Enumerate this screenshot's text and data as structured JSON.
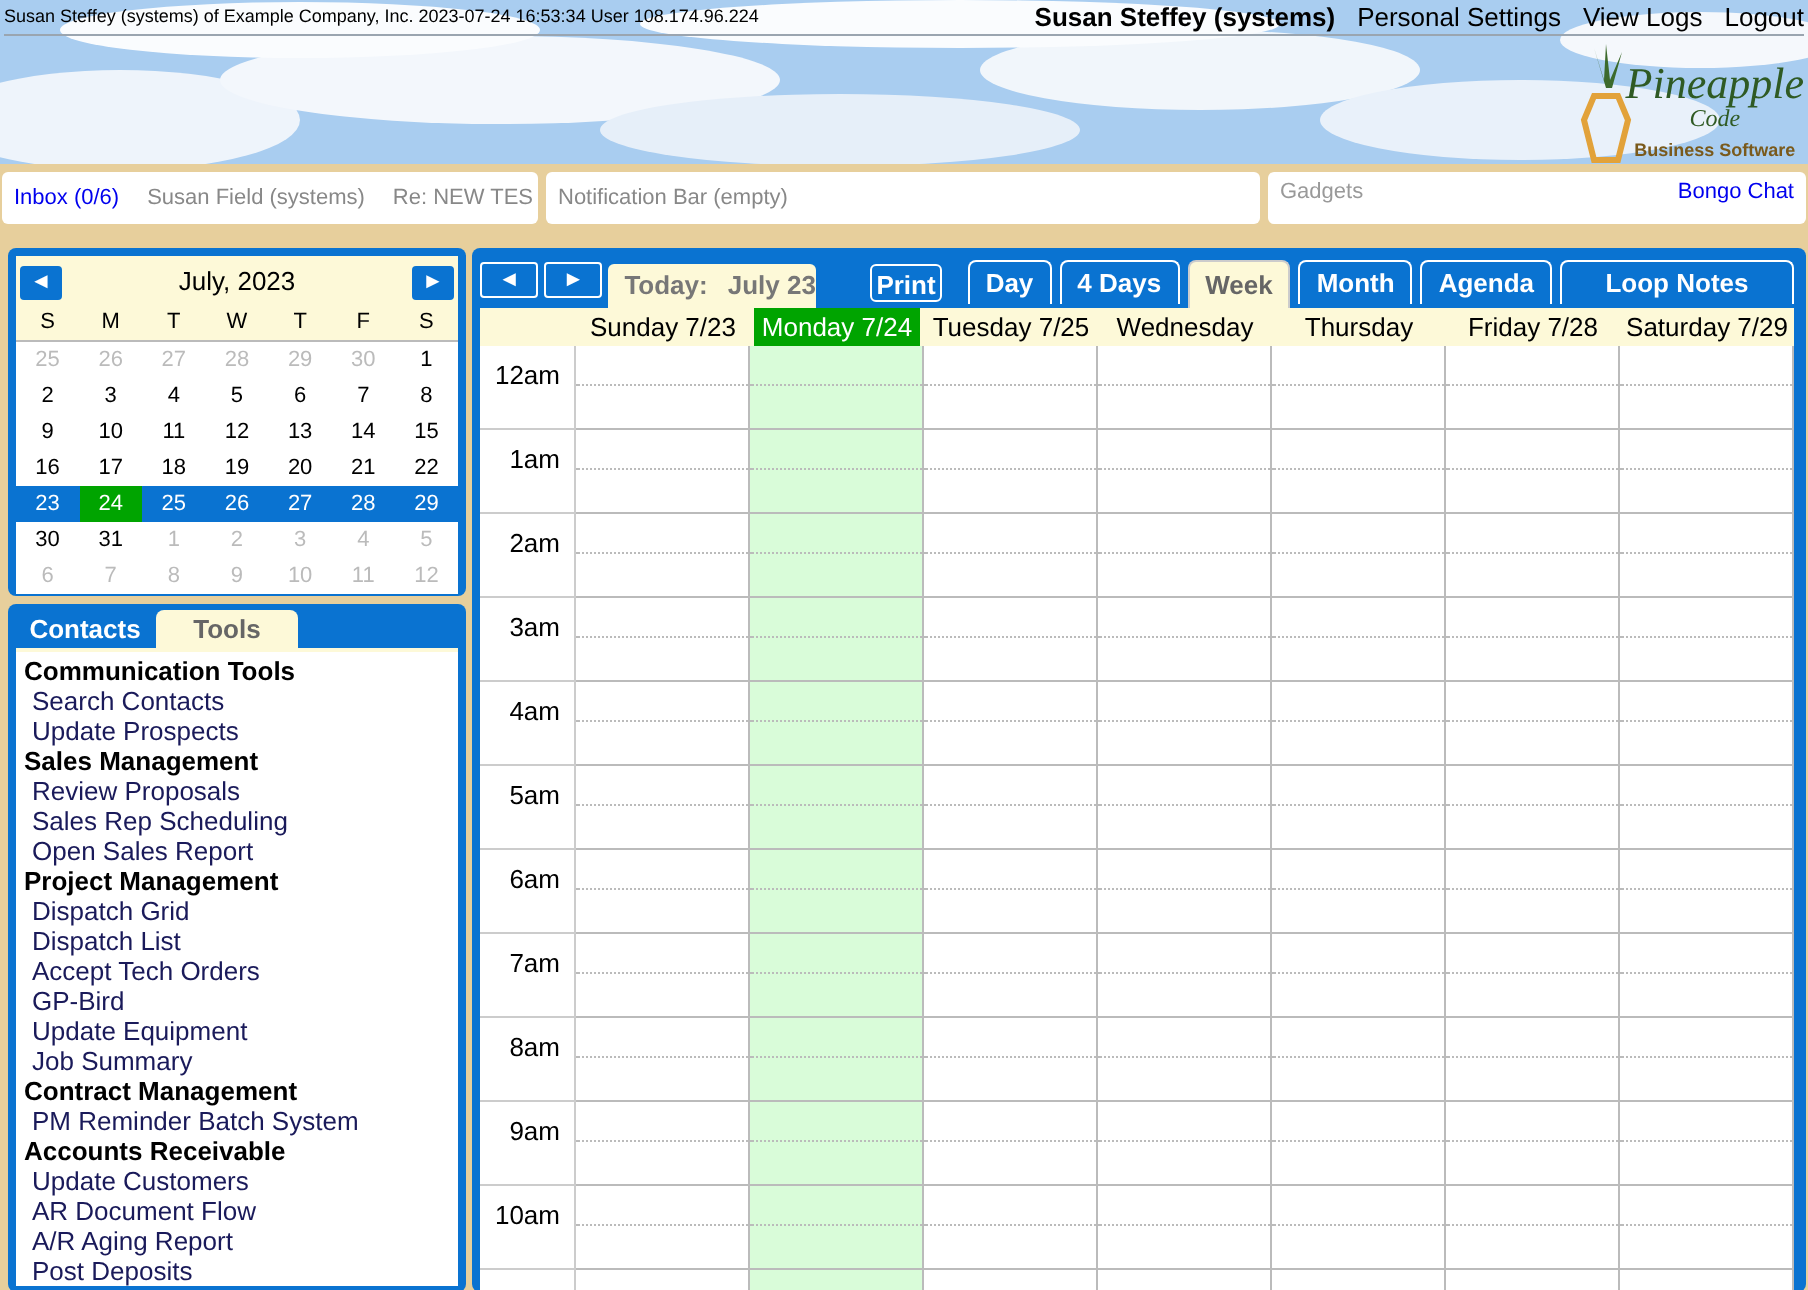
{
  "header": {
    "session_info": "Susan Steffey (systems) of Example Company, Inc. 2023-07-24 16:53:34 User 108.174.96.224",
    "user": "Susan Steffey (systems)",
    "links": [
      "Personal Settings",
      "View Logs",
      "Logout"
    ]
  },
  "logo": {
    "name": "Pineapple",
    "sub": "Code",
    "tagline": "Business Software"
  },
  "message_bar": {
    "inbox": "Inbox (0/6)",
    "sender": "Susan Field (systems)",
    "subject": "Re: NEW TES"
  },
  "notification_bar": "Notification Bar (empty)",
  "gadgets": {
    "label": "Gadgets",
    "link": "Bongo Chat"
  },
  "mini_calendar": {
    "prev": "◄",
    "next": "►",
    "title": "July, 2023",
    "weekdays": [
      "S",
      "M",
      "T",
      "W",
      "T",
      "F",
      "S"
    ],
    "weeks": [
      {
        "selected": false,
        "days": [
          {
            "label": "25",
            "muted": true,
            "today": false
          },
          {
            "label": "26",
            "muted": true,
            "today": false
          },
          {
            "label": "27",
            "muted": true,
            "today": false
          },
          {
            "label": "28",
            "muted": true,
            "today": false
          },
          {
            "label": "29",
            "muted": true,
            "today": false
          },
          {
            "label": "30",
            "muted": true,
            "today": false
          },
          {
            "label": "1",
            "muted": false,
            "today": false
          }
        ]
      },
      {
        "selected": false,
        "days": [
          {
            "label": "2",
            "muted": false,
            "today": false
          },
          {
            "label": "3",
            "muted": false,
            "today": false
          },
          {
            "label": "4",
            "muted": false,
            "today": false
          },
          {
            "label": "5",
            "muted": false,
            "today": false
          },
          {
            "label": "6",
            "muted": false,
            "today": false
          },
          {
            "label": "7",
            "muted": false,
            "today": false
          },
          {
            "label": "8",
            "muted": false,
            "today": false
          }
        ]
      },
      {
        "selected": false,
        "days": [
          {
            "label": "9",
            "muted": false,
            "today": false
          },
          {
            "label": "10",
            "muted": false,
            "today": false
          },
          {
            "label": "11",
            "muted": false,
            "today": false
          },
          {
            "label": "12",
            "muted": false,
            "today": false
          },
          {
            "label": "13",
            "muted": false,
            "today": false
          },
          {
            "label": "14",
            "muted": false,
            "today": false
          },
          {
            "label": "15",
            "muted": false,
            "today": false
          }
        ]
      },
      {
        "selected": false,
        "days": [
          {
            "label": "16",
            "muted": false,
            "today": false
          },
          {
            "label": "17",
            "muted": false,
            "today": false
          },
          {
            "label": "18",
            "muted": false,
            "today": false
          },
          {
            "label": "19",
            "muted": false,
            "today": false
          },
          {
            "label": "20",
            "muted": false,
            "today": false
          },
          {
            "label": "21",
            "muted": false,
            "today": false
          },
          {
            "label": "22",
            "muted": false,
            "today": false
          }
        ]
      },
      {
        "selected": true,
        "days": [
          {
            "label": "23",
            "muted": false,
            "today": false
          },
          {
            "label": "24",
            "muted": false,
            "today": true
          },
          {
            "label": "25",
            "muted": false,
            "today": false
          },
          {
            "label": "26",
            "muted": false,
            "today": false
          },
          {
            "label": "27",
            "muted": false,
            "today": false
          },
          {
            "label": "28",
            "muted": false,
            "today": false
          },
          {
            "label": "29",
            "muted": false,
            "today": false
          }
        ]
      },
      {
        "selected": false,
        "days": [
          {
            "label": "30",
            "muted": false,
            "today": false
          },
          {
            "label": "31",
            "muted": false,
            "today": false
          },
          {
            "label": "1",
            "muted": true,
            "today": false
          },
          {
            "label": "2",
            "muted": true,
            "today": false
          },
          {
            "label": "3",
            "muted": true,
            "today": false
          },
          {
            "label": "4",
            "muted": true,
            "today": false
          },
          {
            "label": "5",
            "muted": true,
            "today": false
          }
        ]
      },
      {
        "selected": false,
        "days": [
          {
            "label": "6",
            "muted": true,
            "today": false
          },
          {
            "label": "7",
            "muted": true,
            "today": false
          },
          {
            "label": "8",
            "muted": true,
            "today": false
          },
          {
            "label": "9",
            "muted": true,
            "today": false
          },
          {
            "label": "10",
            "muted": true,
            "today": false
          },
          {
            "label": "11",
            "muted": true,
            "today": false
          },
          {
            "label": "12",
            "muted": true,
            "today": false
          }
        ]
      }
    ]
  },
  "side_tabs": [
    {
      "label": "Contacts",
      "selected": false
    },
    {
      "label": "Tools",
      "selected": true
    }
  ],
  "tools": [
    {
      "kind": "heading",
      "label": "Communication Tools"
    },
    {
      "kind": "link",
      "label": "Search Contacts"
    },
    {
      "kind": "link",
      "label": "Update Prospects"
    },
    {
      "kind": "heading",
      "label": "Sales Management"
    },
    {
      "kind": "link",
      "label": "Review Proposals"
    },
    {
      "kind": "link",
      "label": "Sales Rep Scheduling"
    },
    {
      "kind": "link",
      "label": "Open Sales Report"
    },
    {
      "kind": "heading",
      "label": "Project Management"
    },
    {
      "kind": "link",
      "label": "Dispatch Grid"
    },
    {
      "kind": "link",
      "label": "Dispatch List"
    },
    {
      "kind": "link",
      "label": "Accept Tech Orders"
    },
    {
      "kind": "link",
      "label": "GP-Bird"
    },
    {
      "kind": "link",
      "label": "Update Equipment"
    },
    {
      "kind": "link",
      "label": "Job Summary"
    },
    {
      "kind": "heading",
      "label": "Contract Management"
    },
    {
      "kind": "link",
      "label": "PM Reminder Batch System"
    },
    {
      "kind": "heading",
      "label": "Accounts Receivable"
    },
    {
      "kind": "link",
      "label": "Update Customers"
    },
    {
      "kind": "link",
      "label": "AR Document Flow"
    },
    {
      "kind": "link",
      "label": "A/R Aging Report"
    },
    {
      "kind": "link",
      "label": "Post Deposits"
    }
  ],
  "calendar": {
    "prev": "◄",
    "next": "►",
    "today_label": "Today:",
    "today_value": "July 23",
    "print": "Print",
    "views": [
      {
        "label": "Day",
        "selected": false
      },
      {
        "label": "4 Days",
        "selected": false
      },
      {
        "label": "Week",
        "selected": true
      },
      {
        "label": "Month",
        "selected": false
      },
      {
        "label": "Agenda",
        "selected": false
      },
      {
        "label": "Loop Notes",
        "selected": false
      }
    ],
    "days": [
      {
        "label": "Sunday 7/23",
        "selected": false
      },
      {
        "label": "Monday 7/24",
        "selected": true
      },
      {
        "label": "Tuesday 7/25",
        "selected": false
      },
      {
        "label": "Wednesday",
        "selected": false
      },
      {
        "label": "Thursday",
        "selected": false
      },
      {
        "label": "Friday 7/28",
        "selected": false
      },
      {
        "label": "Saturday 7/29",
        "selected": false
      }
    ],
    "hours": [
      "12am",
      "1am",
      "2am",
      "3am",
      "4am",
      "5am",
      "6am",
      "7am",
      "8am",
      "9am",
      "10am"
    ]
  }
}
